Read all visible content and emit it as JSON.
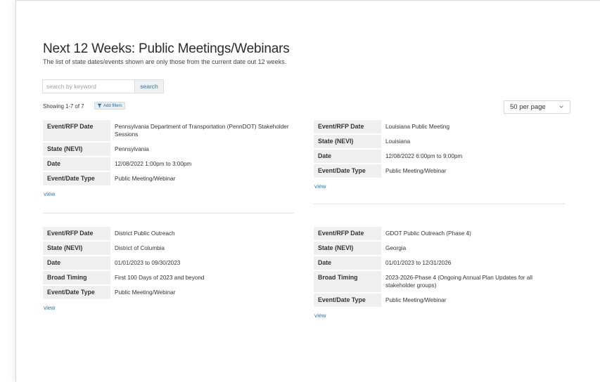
{
  "page": {
    "title": "Next 12 Weeks: Public Meetings/Webinars",
    "subtitle": "The list of state dates/events shown are only those from the current date out 12 weeks."
  },
  "search": {
    "placeholder": "search by keyword",
    "button_label": "search"
  },
  "results": {
    "showing": "Showing 1-7 of 7",
    "filters_label": "Add filters",
    "per_page": "50 per page"
  },
  "events": [
    {
      "rows": [
        {
          "label": "Event/RFP Date",
          "value": "Pennsylvania Department of Transportation (PennDOT) Stakeholder Sessions"
        },
        {
          "label": "State (NEVI)",
          "value": "Pennsylvania"
        },
        {
          "label": "Date",
          "value": "12/08/2022 1:00pm to 3:00pm"
        },
        {
          "label": "Event/Date Type",
          "value": "Public Meeting/Webinar"
        }
      ],
      "view_label": "view"
    },
    {
      "rows": [
        {
          "label": "Event/RFP Date",
          "value": "Louisiana Public Meeting"
        },
        {
          "label": "State (NEVI)",
          "value": "Louisiana"
        },
        {
          "label": "Date",
          "value": "12/08/2022 6:00pm to 9:00pm"
        },
        {
          "label": "Event/Date Type",
          "value": "Public Meeting/Webinar"
        }
      ],
      "view_label": "view"
    },
    {
      "rows": [
        {
          "label": "Event/RFP Date",
          "value": "District Public Outreach"
        },
        {
          "label": "State (NEVI)",
          "value": "District of Columbia"
        },
        {
          "label": "Date",
          "value": "01/01/2023 to 09/30/2023"
        },
        {
          "label": "Broad Timing",
          "value": "First 100 Days of 2023 and beyond"
        },
        {
          "label": "Event/Date Type",
          "value": "Public Meeting/Webinar"
        }
      ],
      "view_label": "view"
    },
    {
      "rows": [
        {
          "label": "Event/RFP Date",
          "value": "GDOT Public Outreach (Phase 4)"
        },
        {
          "label": "State (NEVI)",
          "value": "Georgia"
        },
        {
          "label": "Date",
          "value": "01/01/2023 to 12/31/2026"
        },
        {
          "label": "Broad Timing",
          "value": "2023-2026-Phase 4 (Ongoing Annual Plan Updates for all stakeholder groups)"
        },
        {
          "label": "Event/Date Type",
          "value": "Public Meeting/Webinar"
        }
      ],
      "view_label": "view"
    }
  ],
  "colors": {
    "link": "#2a7ab0",
    "label_background": "#efefef",
    "button_background": "#eef1f3"
  },
  "icons": {
    "filter": "filter-icon",
    "per_page_dropdown": "chevron-down-icon"
  }
}
